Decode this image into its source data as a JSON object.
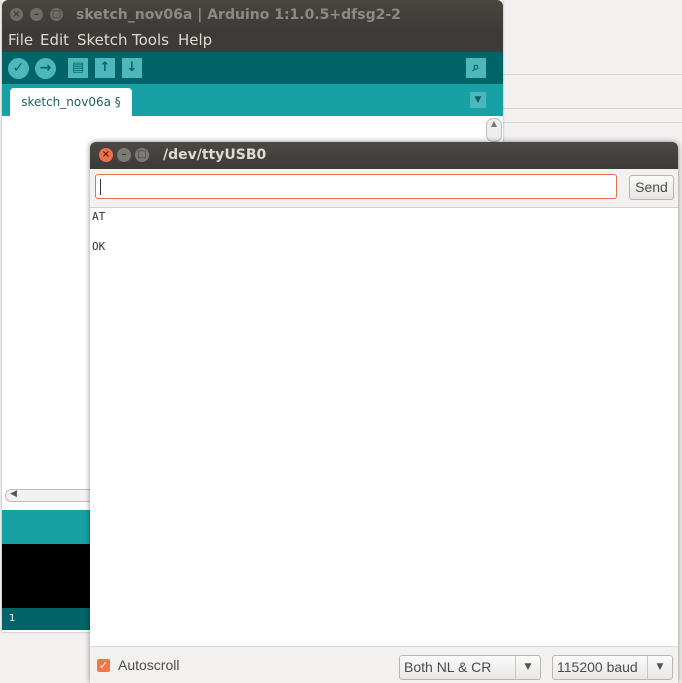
{
  "ide": {
    "title": "sketch_nov06a | Arduino 1:1.0.5+dfsg2-2",
    "menu": [
      "File",
      "Edit",
      "Sketch",
      "Tools",
      "Help"
    ],
    "tab_label": "sketch_nov06a §",
    "line_number": "1"
  },
  "serial_monitor": {
    "title": "/dev/ttyUSB0",
    "input_value": "",
    "send_label": "Send",
    "output_lines": [
      "AT",
      "OK"
    ],
    "autoscroll_label": "Autoscroll",
    "autoscroll_checked": true,
    "line_ending": "Both NL & CR",
    "baud_rate": "115200 baud"
  },
  "colors": {
    "arduino_teal_dark": "#006468",
    "arduino_teal": "#17a1a5",
    "close_button": "#f0704a",
    "input_border": "#e2714f"
  }
}
